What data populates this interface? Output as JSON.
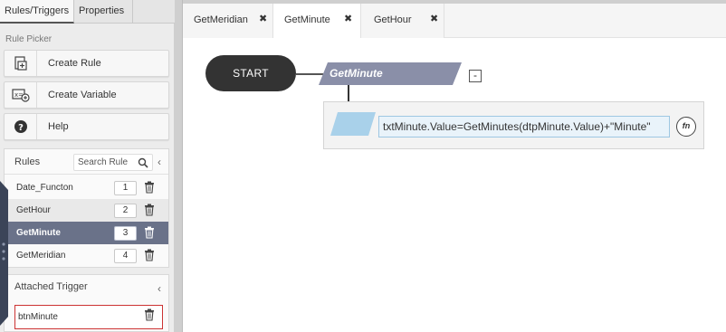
{
  "left_tabs": [
    "Rules/Triggers",
    "Properties"
  ],
  "rule_picker": {
    "label": "Rule Picker",
    "buttons": [
      {
        "label": "Create Rule",
        "icon": "create-rule-icon"
      },
      {
        "label": "Create Variable",
        "icon": "create-variable-icon"
      },
      {
        "label": "Help",
        "icon": "help-icon"
      }
    ]
  },
  "rules": {
    "title": "Rules",
    "search_placeholder": "Search Rule",
    "items": [
      {
        "name": "Date_Functon",
        "num": "1",
        "state": "normal"
      },
      {
        "name": "GetHour",
        "num": "2",
        "state": "hover"
      },
      {
        "name": "GetMinute",
        "num": "3",
        "state": "active"
      },
      {
        "name": "GetMeridian",
        "num": "4",
        "state": "normal"
      }
    ]
  },
  "attached_trigger": {
    "title": "Attached Trigger",
    "items": [
      {
        "name": "btnMinute"
      }
    ]
  },
  "doc_tabs": [
    {
      "label": "GetMeridian",
      "active": false
    },
    {
      "label": "GetMinute",
      "active": true
    },
    {
      "label": "GetHour",
      "active": false
    }
  ],
  "canvas": {
    "start_label": "START",
    "rule_label": "GetMinute",
    "collapse_label": "-",
    "action_text": "txtMinute.Value=GetMinutes(dtpMinute.Value)+\"Minute\"",
    "fn_label": "fn"
  },
  "colors": {
    "rule_parallelogram": "#8a8fa8",
    "action_parallelogram": "#a9d1ea",
    "active_row": "#6a7289",
    "start_node": "#333333",
    "trigger_border": "#cc3333"
  }
}
